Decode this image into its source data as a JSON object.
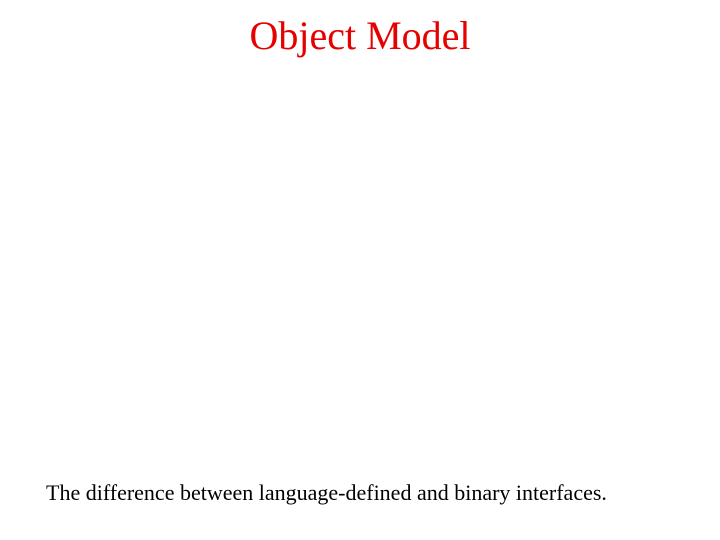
{
  "title": "Object Model",
  "caption": "The difference between language-defined and binary interfaces."
}
